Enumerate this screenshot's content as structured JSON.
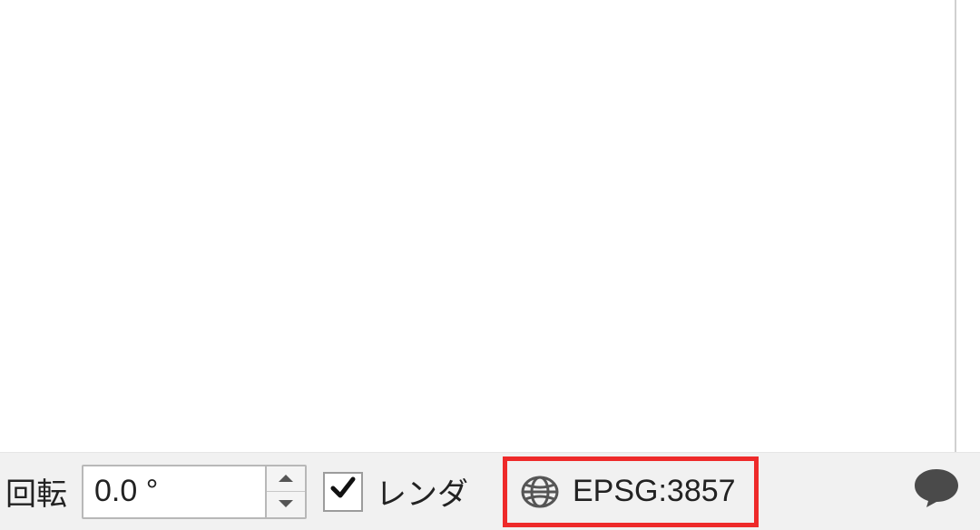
{
  "statusbar": {
    "rotation_label": "回転",
    "rotation_value": "0.0 °",
    "render_label": "レンダ",
    "render_checked": true,
    "crs_label": "EPSG:3857"
  }
}
